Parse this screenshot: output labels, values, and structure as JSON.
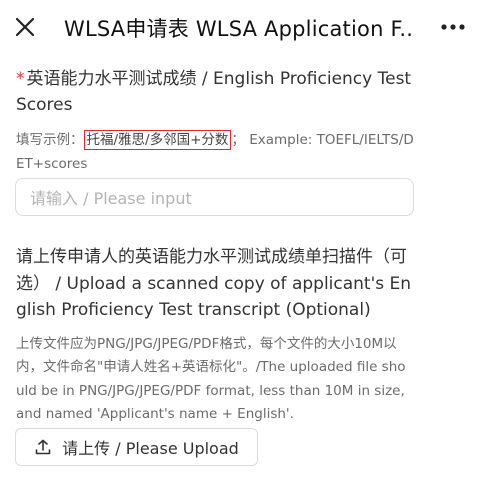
{
  "header": {
    "title": "WLSA申请表 WLSA Application F..."
  },
  "english_scores": {
    "required_mark": "*",
    "label": "英语能力水平测试成绩 / English Proficiency Test Scores",
    "hint_prefix": "填写示例：",
    "hint_highlight": "托福/雅思/多邻国+分数",
    "hint_suffix": "；  Example: TOEFL/IELTS/DET+scores",
    "input_placeholder": "请输入 / Please input"
  },
  "transcript_upload": {
    "label": "请上传申请人的英语能力水平测试成绩单扫描件（可选） / Upload a scanned copy of applicant's English Proficiency Test transcript (Optional)",
    "hint": "上传文件应为PNG/JPG/JPEG/PDF格式，每个文件的大小10M以内，文件命名\"申请人姓名+英语标化\"。/The uploaded file should be in PNG/JPG/JPEG/PDF format, less than 10M in size, and named 'Applicant's name + English'.",
    "button_label": "请上传 / Please Upload"
  },
  "icons": {
    "close": "close-icon",
    "more": "more-icon",
    "upload": "upload-icon"
  },
  "colors": {
    "required": "#e0383e",
    "highlight_border": "#e8262c",
    "placeholder": "#b3b3b3"
  }
}
